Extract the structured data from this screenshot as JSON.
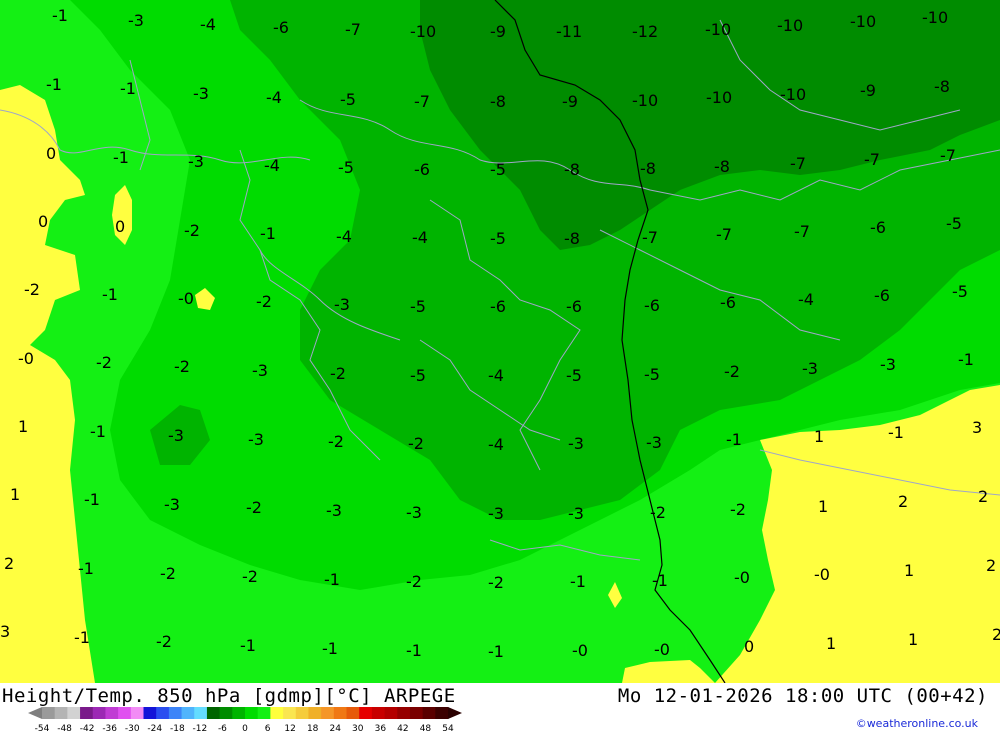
{
  "header": {
    "title_left": "Height/Temp. 850 hPa [gdmp][°C] ARPEGE",
    "title_right": "Mo 12-01-2026 18:00 UTC (00+42)"
  },
  "credit": "©weatheronline.co.uk",
  "legend": {
    "ticks": [
      "-54",
      "-48",
      "-42",
      "-36",
      "-30",
      "-24",
      "-18",
      "-12",
      "-6",
      "0",
      "6",
      "12",
      "18",
      "24",
      "30",
      "36",
      "42",
      "48",
      "54"
    ],
    "colors": [
      "#9a9a9a",
      "#b4b4b4",
      "#d2d2d2",
      "#7a1a8a",
      "#9c28b4",
      "#c03cd4",
      "#e050f0",
      "#f28cf5",
      "#1414d8",
      "#2a4ef0",
      "#3c84f8",
      "#50b4fc",
      "#64dcff",
      "#006400",
      "#008c00",
      "#00b400",
      "#00dc00",
      "#14f014",
      "#ffff3c",
      "#fae650",
      "#f5cc3c",
      "#f0b028",
      "#f59628",
      "#f07814",
      "#e65a0a",
      "#e60000",
      "#c80000",
      "#b40000",
      "#960000",
      "#7a0000",
      "#5a0000",
      "#3c0000"
    ]
  },
  "map": {
    "colors": {
      "yellow": "#ffff40",
      "green_light": "#14f014",
      "green_mid": "#00dc00",
      "green_dark": "#00b400",
      "green_deep": "#008c00",
      "border": "#9fa6c8",
      "line": "#000000"
    },
    "temps": [
      "-1",
      "-3",
      "-4",
      "-6",
      "-7",
      "-10",
      "-9",
      "-11",
      "-12",
      "-10",
      "-10",
      "-10",
      "-10",
      "-1",
      "-1",
      "-3",
      "-4",
      "-5",
      "-7",
      "-8",
      "-9",
      "-10",
      "-10",
      "-10",
      "-9",
      "-8",
      "0",
      "-1",
      "-3",
      "-4",
      "-5",
      "-6",
      "-5",
      "-8",
      "-8",
      "-8",
      "-7",
      "-7",
      "-7",
      "0",
      "0",
      "-2",
      "-1",
      "-4",
      "-4",
      "-5",
      "-8",
      "-7",
      "-7",
      "-7",
      "-6",
      "-5",
      "-2",
      "-1",
      "-0",
      "-2",
      "-3",
      "-5",
      "-6",
      "-6",
      "-6",
      "-6",
      "-4",
      "-6",
      "-5",
      "-0",
      "-2",
      "-2",
      "-3",
      "-2",
      "-5",
      "-4",
      "-5",
      "-5",
      "-2",
      "-3",
      "-3",
      "-1",
      "1",
      "-1",
      "-3",
      "-3",
      "-2",
      "-2",
      "-4",
      "-3",
      "-3",
      "-1",
      "1",
      "-1",
      "3",
      "1",
      "-1",
      "-3",
      "-2",
      "-3",
      "-3",
      "-3",
      "-3",
      "-2",
      "-2",
      "1",
      "2",
      "2",
      "2",
      "-1",
      "-2",
      "-2",
      "-1",
      "-2",
      "-2",
      "-1",
      "-1",
      "-0",
      "-0",
      "1",
      "2",
      "3",
      "-1",
      "-2",
      "-1",
      "-1",
      "-1",
      "-1",
      "-0",
      "-0",
      "0",
      "1",
      "1",
      "2"
    ]
  }
}
